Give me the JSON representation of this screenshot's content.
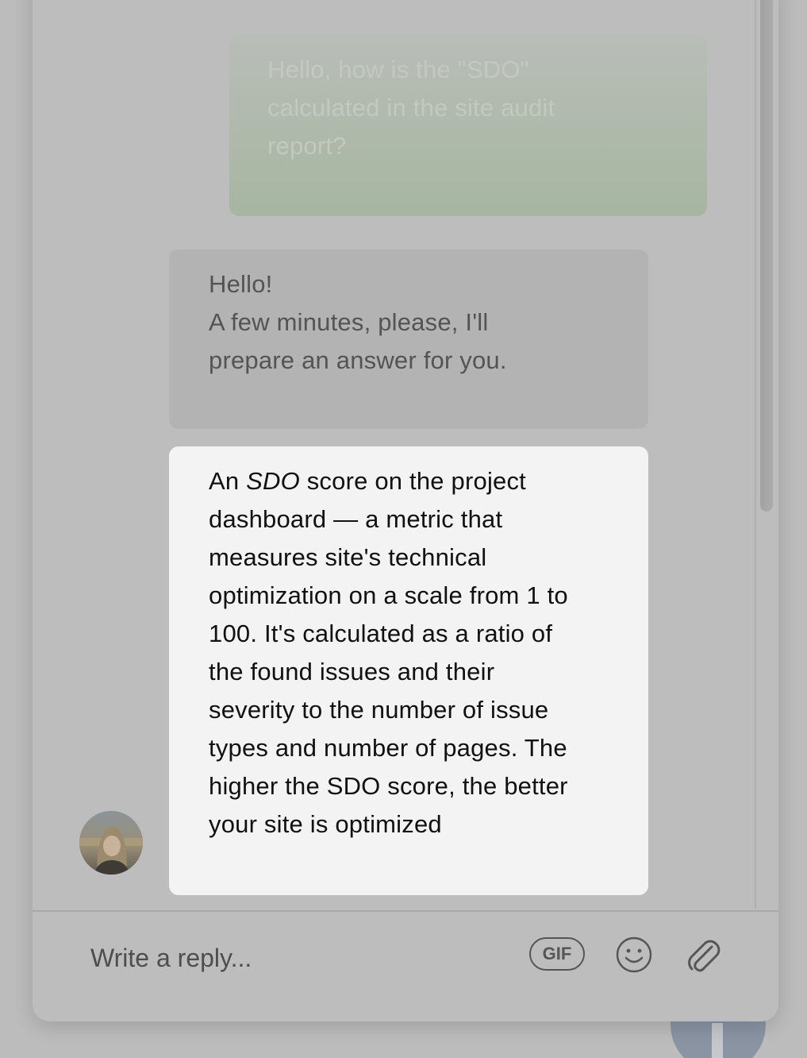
{
  "conversation": {
    "user_message": {
      "lines": [
        "Hello, how is the \"SDO\"",
        "calculated in the site audit",
        "report?"
      ]
    },
    "agent_message_1": {
      "lines": [
        "Hello!",
        "A few minutes, please, I'll",
        "prepare an answer for you."
      ]
    },
    "agent_message_2": {
      "first_line_prefix": "An ",
      "first_line_emphasis": "SDO",
      "first_line_suffix": " score on the project",
      "lines": [
        "dashboard — a metric that",
        "measures site's technical",
        "optimization on a scale from 1 to",
        "100. It's calculated as a ratio of",
        "the found issues and their",
        "severity to the number of issue",
        "types and number of pages. The",
        "higher the SDO score, the better",
        "your site is optimized"
      ]
    },
    "agent_avatar_icon": "avatar-icon"
  },
  "composer": {
    "placeholder": "Write a reply...",
    "gif_label": "GIF",
    "emoji_icon": "smiley-icon",
    "attach_icon": "paperclip-icon"
  },
  "colors": {
    "user_bubble": "#a6b6a0",
    "agent_bubble_dim": "#b3b3b3",
    "agent_bubble": "#f3f3f3",
    "overlay_bg": "#bcbcbc"
  }
}
